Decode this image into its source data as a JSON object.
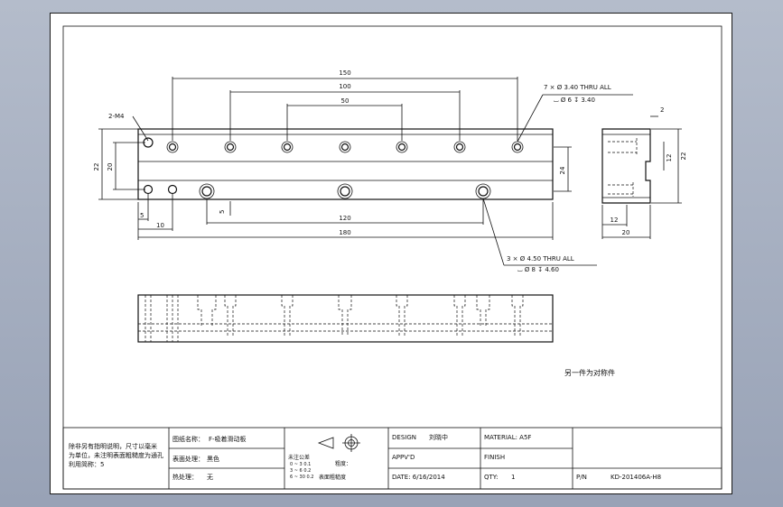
{
  "dims": {
    "d150": "150",
    "d100": "100",
    "d50": "50",
    "d120": "120",
    "d180": "180",
    "d22": "22",
    "d20": "20",
    "d24": "24",
    "d5a": "5",
    "d5b": "5",
    "d10": "10",
    "side_d2": "2",
    "side_d12v": "12",
    "side_d22": "22",
    "side_d12h": "12",
    "side_d20": "20"
  },
  "callouts": {
    "m4": "2-M4",
    "hole1_line1": "7 × Ø 3.40 THRU ALL",
    "hole1_line2": "⌴ Ø 6 ↧ 3.40",
    "hole2_line1": "3 × Ø 4.50 THRU ALL",
    "hole2_line2": "⌴ Ø 8 ↧ 4.60"
  },
  "note_main": "另一件为对称件",
  "title_block": {
    "notes": [
      "除非另有指明说明，尺寸以毫米",
      "为单位，未注明表面粗糙度为通孔",
      "利用简称：5"
    ],
    "part_name_label": "图纸名称：",
    "part_name": "F-吸着滑动板",
    "surface_label": "表面处理：",
    "surface": "黑色",
    "heat_label": "热处理：",
    "heat": "无",
    "tol_title": "未注公差",
    "tol_lines": [
      "0 ~ 3   0.1",
      "3 ~ 6   0.2",
      "6 ~ 30  0.2"
    ],
    "rough_label": "粗度：",
    "surface_rough": "表面粗糙度",
    "design_label": "DESIGN",
    "designer": "刘晓中",
    "material_label": "MATERIAL: A5F",
    "appvd_label": "APPV'D",
    "finish_label": "FINISH",
    "date_label": "DATE: 6/16/2014",
    "qty_label": "QTY:",
    "qty": "1",
    "pn_label": "P/N",
    "pn": "KD-201406A-H8"
  }
}
